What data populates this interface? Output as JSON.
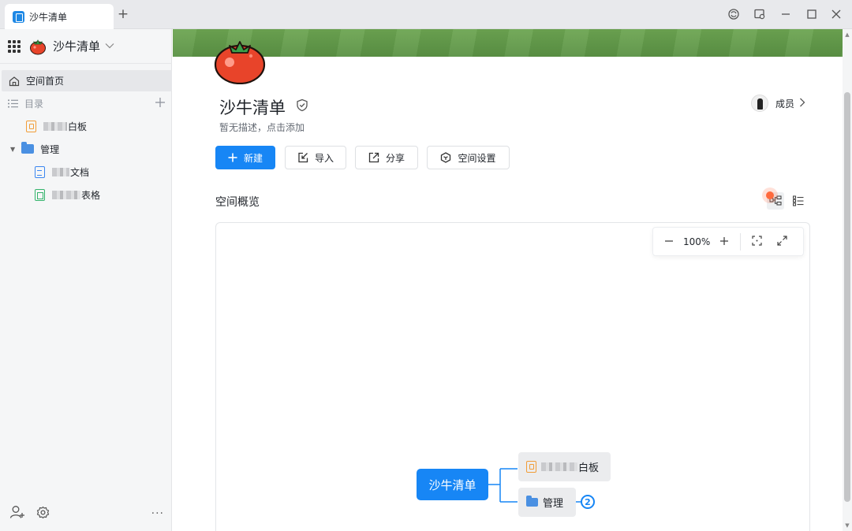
{
  "browser": {
    "tab_title": "沙牛清单",
    "new_tab": "+"
  },
  "sidebar": {
    "space_name": "沙牛清单",
    "home_label": "空间首页",
    "catalog_label": "目录",
    "items": [
      {
        "label": "白板",
        "type": "whiteboard"
      },
      {
        "label": "管理",
        "type": "folder"
      },
      {
        "label": "文档",
        "type": "doc"
      },
      {
        "label": "表格",
        "type": "sheet"
      }
    ],
    "more": "···"
  },
  "space": {
    "title": "沙牛清单",
    "description": "暂无描述，点击添加",
    "members_label": "成员"
  },
  "actions": {
    "new_label": "新建",
    "import_label": "导入",
    "share_label": "分享",
    "settings_label": "空间设置"
  },
  "overview": {
    "title": "空间概览",
    "zoom_level": "100%",
    "mindmap": {
      "root": "沙牛清单",
      "children": [
        {
          "label": "白板"
        },
        {
          "label": "管理",
          "count": "2"
        }
      ]
    }
  },
  "colors": {
    "primary": "#1786f5",
    "banner": "#6da552",
    "tomato": "#e8442a"
  }
}
